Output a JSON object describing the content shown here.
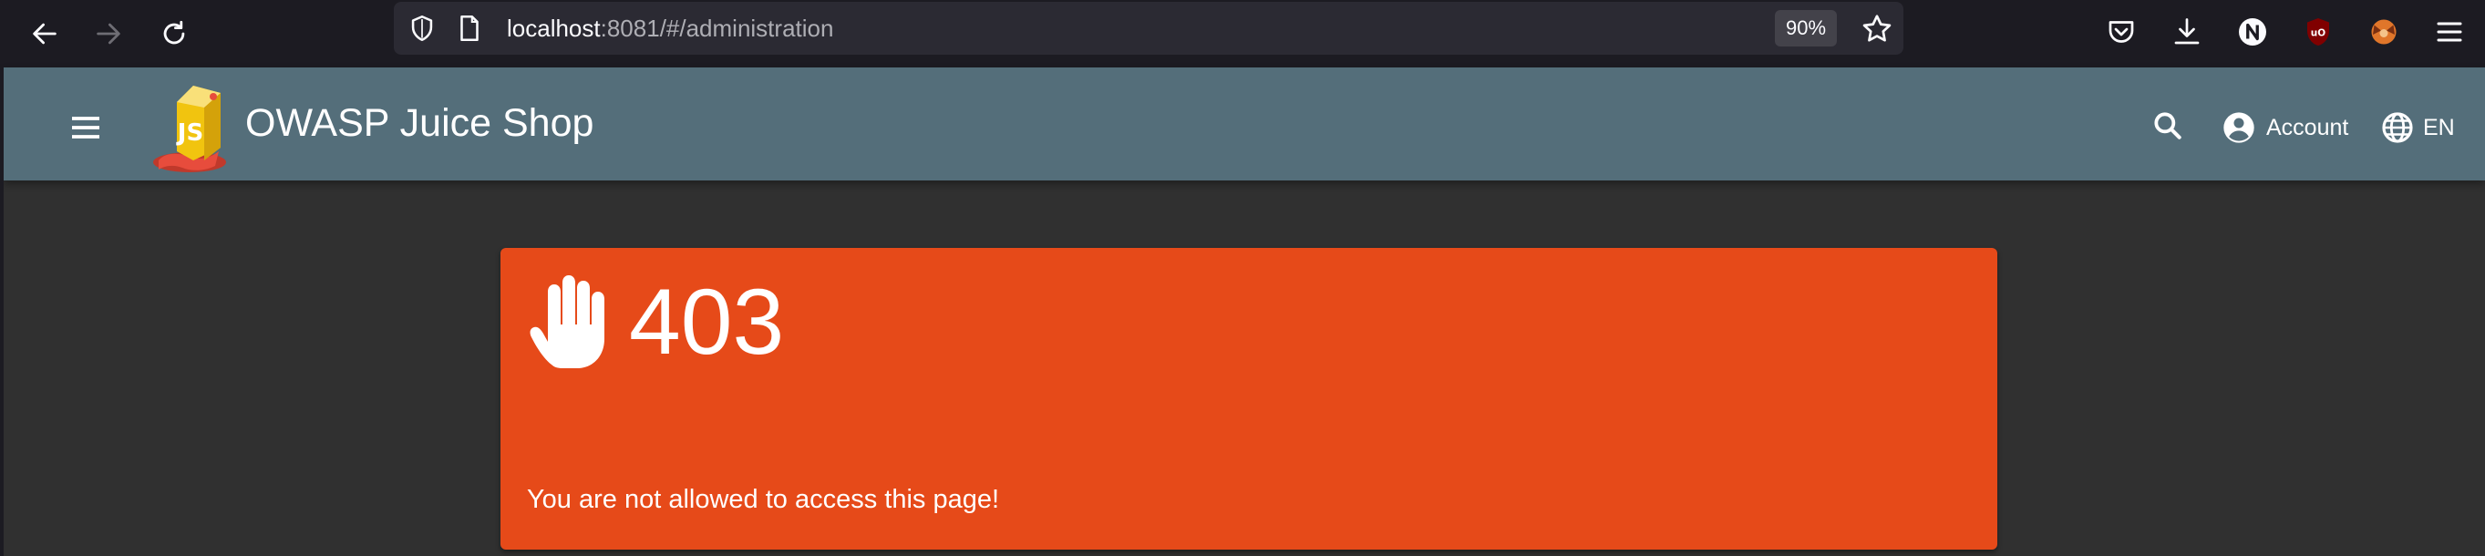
{
  "browser": {
    "url_host": "localhost",
    "url_rest": ":8081/#/administration",
    "zoom": "90%"
  },
  "app": {
    "title": "OWASP Juice Shop",
    "account_label": "Account",
    "language_label": "EN"
  },
  "error": {
    "code": "403",
    "message": "You are not allowed to access this page!"
  },
  "colors": {
    "toolbar": "#546e7a",
    "error_card": "#e64a19",
    "background": "#303030",
    "browser_chrome": "#1c1b22"
  },
  "icons": {
    "back": "back-arrow-icon",
    "forward": "forward-arrow-icon",
    "reload": "reload-icon",
    "shield": "tracking-shield-icon",
    "page": "page-icon",
    "bookmark": "star-icon",
    "pocket": "pocket-icon",
    "downloads": "download-icon",
    "extension_n": "extension-n-icon",
    "ublock": "ublock-icon",
    "extension_fox": "extension-fox-icon",
    "app_menu": "hamburger-icon",
    "sidenav": "menu-icon",
    "search": "search-icon",
    "account": "account-circle-icon",
    "language": "globe-icon",
    "error": "raised-hand-icon"
  }
}
